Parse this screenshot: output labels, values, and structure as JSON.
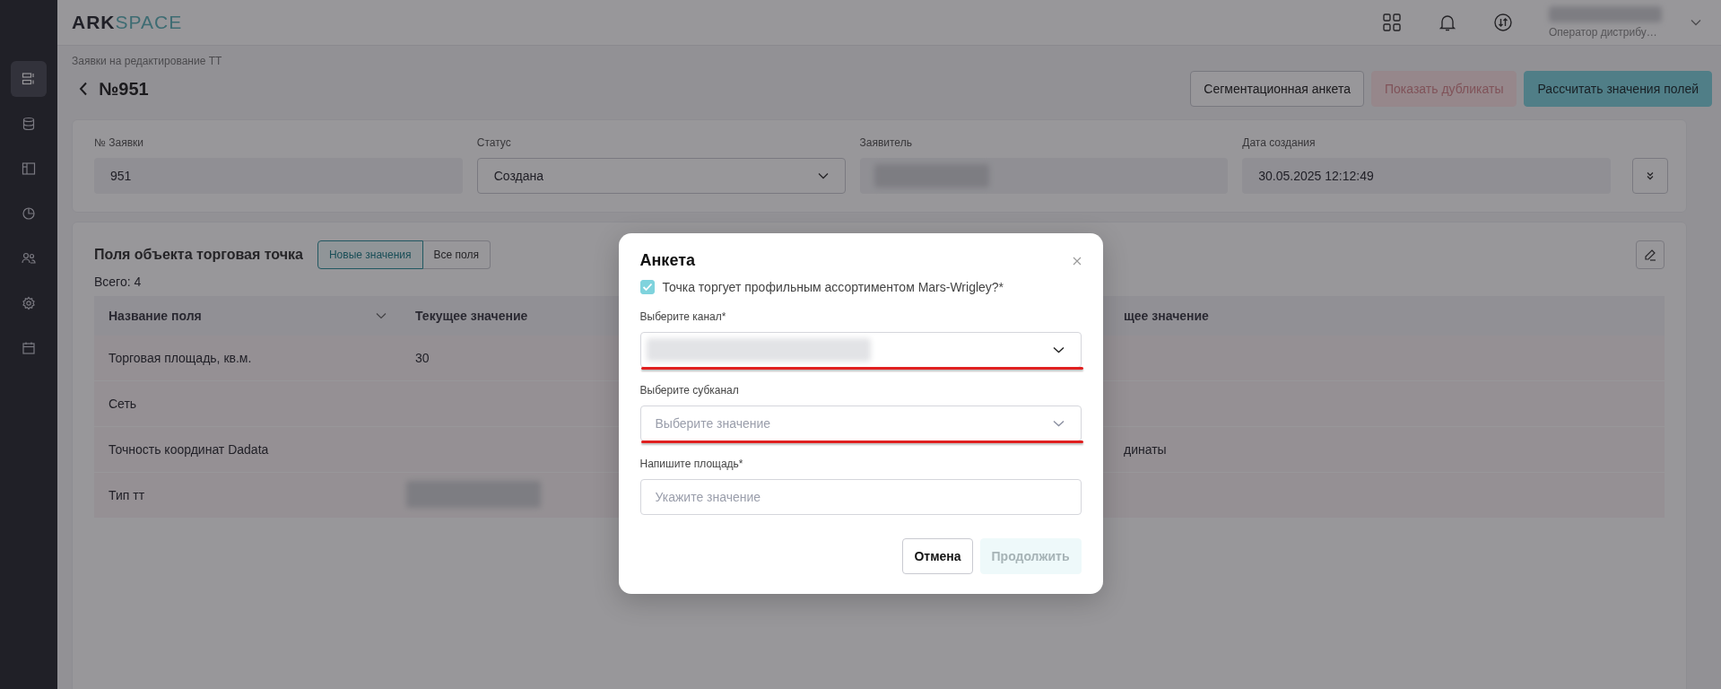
{
  "logo": {
    "left": "ARK",
    "right": "SPACE"
  },
  "topbar": {
    "user": {
      "name_blurred": true,
      "role": "Оператор дистрибу…"
    }
  },
  "sidebar": {
    "items": [
      {
        "kind": "list",
        "selected": true
      },
      {
        "kind": "database",
        "selected": false
      },
      {
        "kind": "layout",
        "selected": false
      },
      {
        "kind": "chart",
        "selected": false
      },
      {
        "kind": "users",
        "selected": false
      },
      {
        "kind": "settings",
        "selected": false
      },
      {
        "kind": "calendar",
        "selected": false
      }
    ]
  },
  "breadcrumb": "Заявки на редактирование ТТ",
  "title": "№951",
  "actions": [
    {
      "label": "Сегментационная анкета",
      "kind": "outline",
      "disabled": false
    },
    {
      "label": "Показать дубликаты",
      "kind": "danger",
      "disabled": true
    },
    {
      "label": "Рассчитать значения полей",
      "kind": "primary",
      "disabled": false
    }
  ],
  "summary": {
    "fields": [
      {
        "label": "№ Заявки",
        "kind": "text",
        "value": "951"
      },
      {
        "label": "Статус",
        "kind": "select",
        "value": "Создана"
      },
      {
        "label": "Заявитель",
        "kind": "text",
        "blurred": true
      },
      {
        "label": "Дата создания",
        "kind": "text",
        "value": "30.05.2025 12:12:49"
      }
    ]
  },
  "fields_panel": {
    "title": "Поля объекта торговая точка",
    "filters": [
      {
        "label": "Новые значения",
        "selected": true
      },
      {
        "label": "Все поля",
        "selected": false
      }
    ],
    "total": "Всего: 4",
    "table": {
      "columns": [
        "Название поля",
        "Текущее значение",
        "щее значение"
      ],
      "rows": [
        {
          "name": "Торговая площадь, кв.м.",
          "current": "30"
        },
        {
          "name": "Сеть"
        },
        {
          "name": "Точность координат Dadata",
          "column_3": "динаты"
        },
        {
          "name": "Тип тт",
          "current_blurred": true
        }
      ]
    }
  },
  "modal": {
    "title": "Анкета",
    "checkbox": {
      "label": "Точка торгует профильным ассортиментом Mars-Wrigley?*",
      "checked": true
    },
    "fields": [
      {
        "label": "Выберите канал*",
        "kind": "select",
        "blurred": true,
        "annotated": true
      },
      {
        "label": "Выберите субканал",
        "kind": "select",
        "placeholder": "Выберите значение",
        "annotated": true
      },
      {
        "label": "Напишите площадь*",
        "kind": "input",
        "placeholder": "Укажите значение",
        "annotated": false
      }
    ],
    "buttons": [
      {
        "label": "Отмена",
        "kind": "secondary",
        "disabled": false
      },
      {
        "label": "Продолжить",
        "kind": "primary",
        "disabled": true
      }
    ]
  }
}
